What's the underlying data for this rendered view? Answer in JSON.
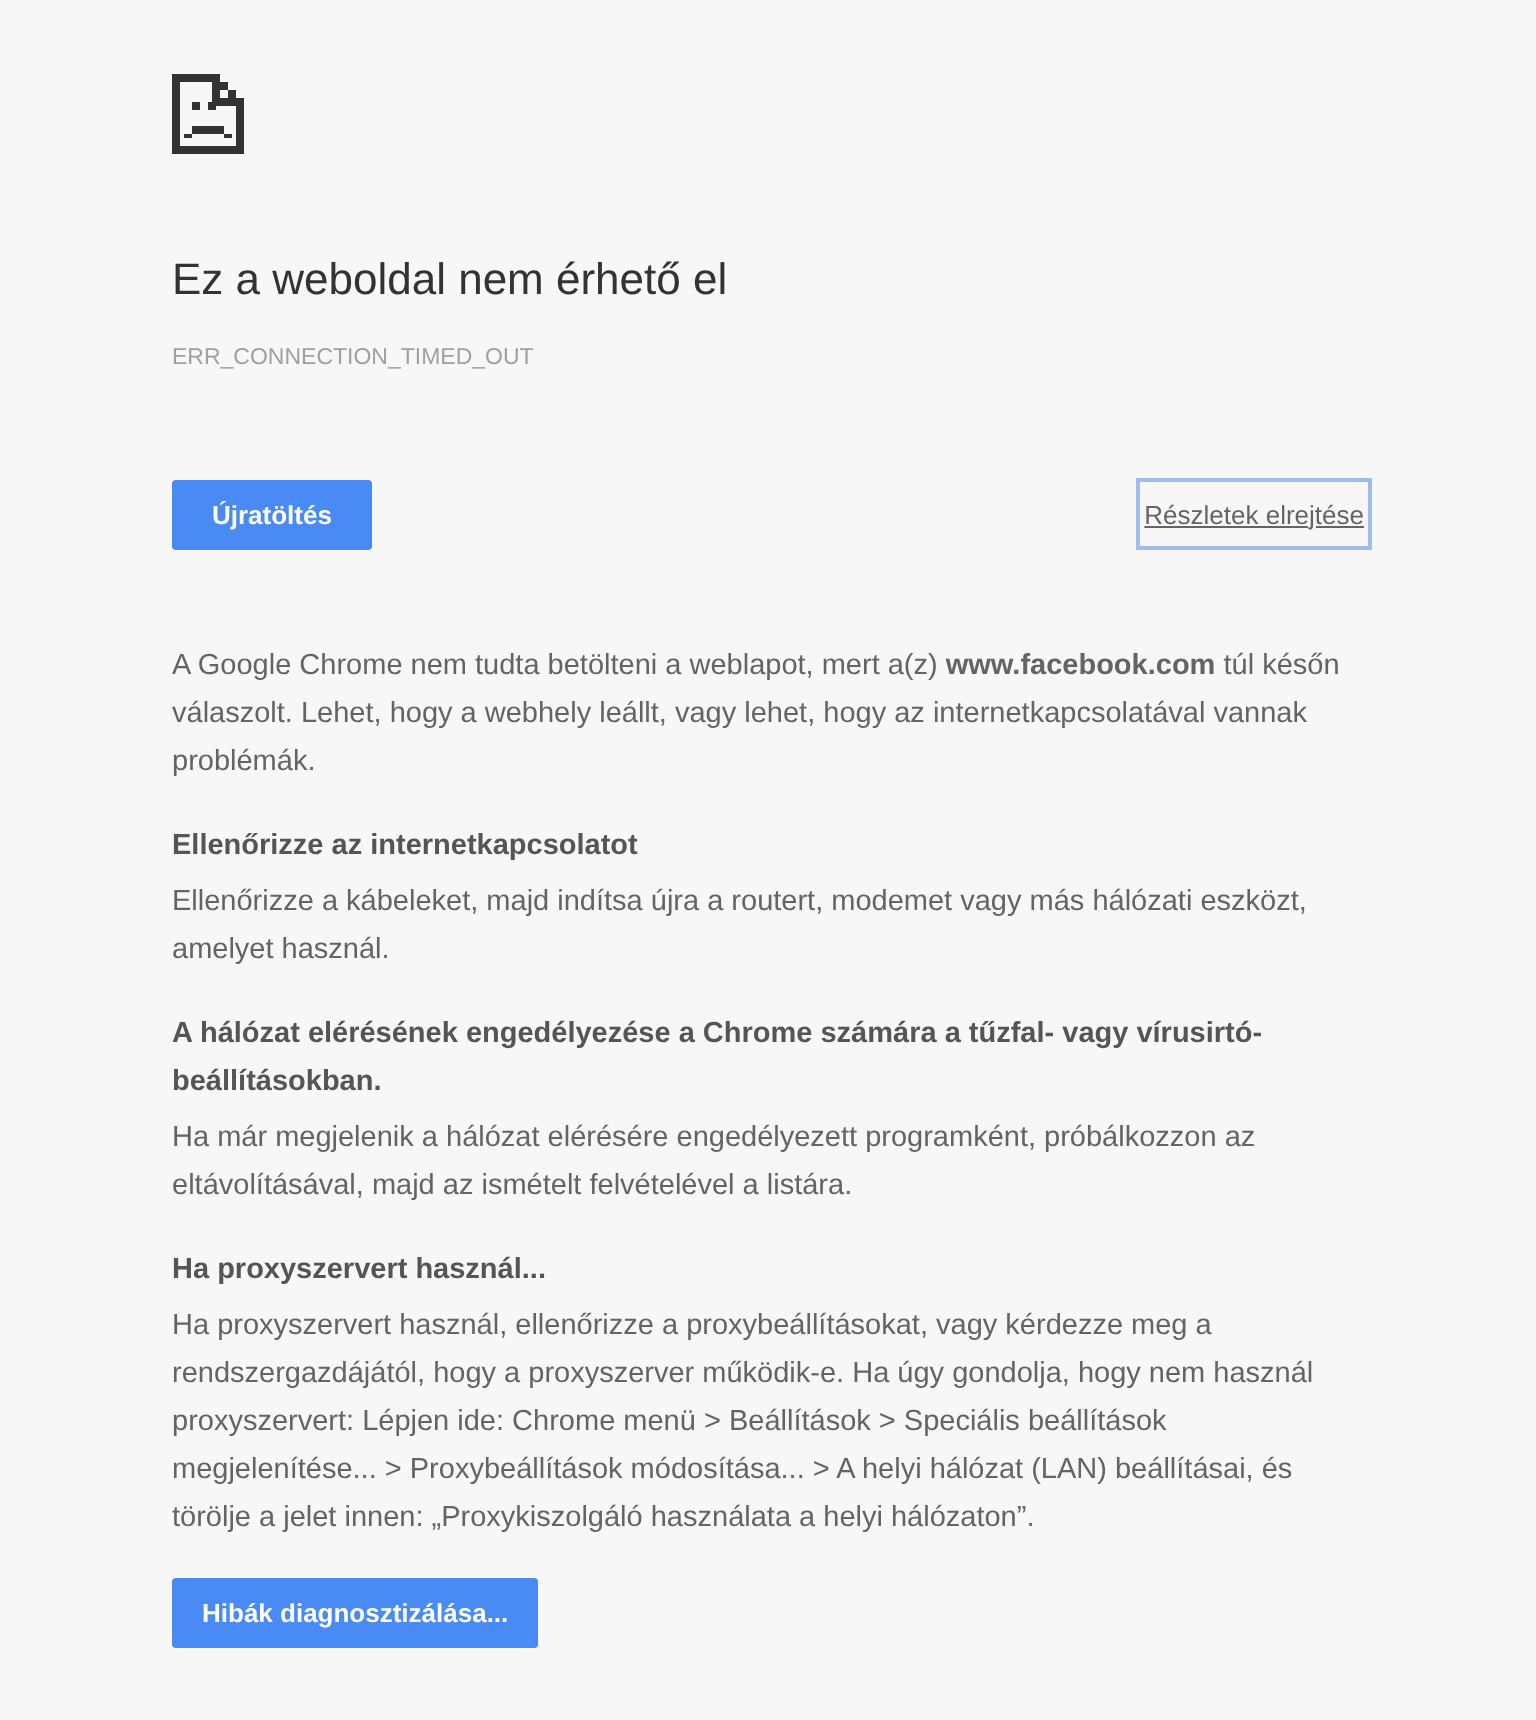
{
  "title": "Ez a weboldal nem érhető el",
  "error_code": "ERR_CONNECTION_TIMED_OUT",
  "reload_button": {
    "label": "Újratöltés"
  },
  "details_button": {
    "label": "Részletek elrejtése",
    "focused": true
  },
  "summary": "A Google Chrome nem tudta betölteni a weblapot, mert a(z) **www.facebook.com** túl későn válaszolt. Lehet, hogy a webhely leállt, vagy lehet, hogy az internetkapcsolatával vannak problémák.",
  "suggestions": [
    {
      "heading": "Ellenőrizze az internetkapcsolatot",
      "text": "Ellenőrizze a kábeleket, majd indítsa újra a routert, modemet vagy más hálózati eszközt, amelyet használ."
    },
    {
      "heading": "A hálózat elérésének engedélyezése a Chrome számára a tűzfal- vagy vírusirtó-beállításokban.",
      "text": "Ha már megjelenik a hálózat elérésére engedélyezett programként, próbálkozzon az eltávolításával, majd az ismételt felvételével a listára."
    },
    {
      "heading": "Ha proxyszervert használ...",
      "text": "Ha proxyszervert használ, ellenőrizze a proxybeállításokat, vagy kérdezze meg a rendszergazdájától, hogy a proxyszerver működik-e. Ha úgy gondolja, hogy nem használ proxyszervert: Lépjen ide: Chrome menü > Beállítások > Speciális beállítások megjelenítése... > Proxybeállítások módosítása... > A helyi hálózat (LAN) beállításai, és törölje a jelet innen: „Proxykiszolgáló használata a helyi hálózaton”."
    }
  ],
  "diagnose_button": {
    "label": "Hibák diagnosztizálása..."
  }
}
